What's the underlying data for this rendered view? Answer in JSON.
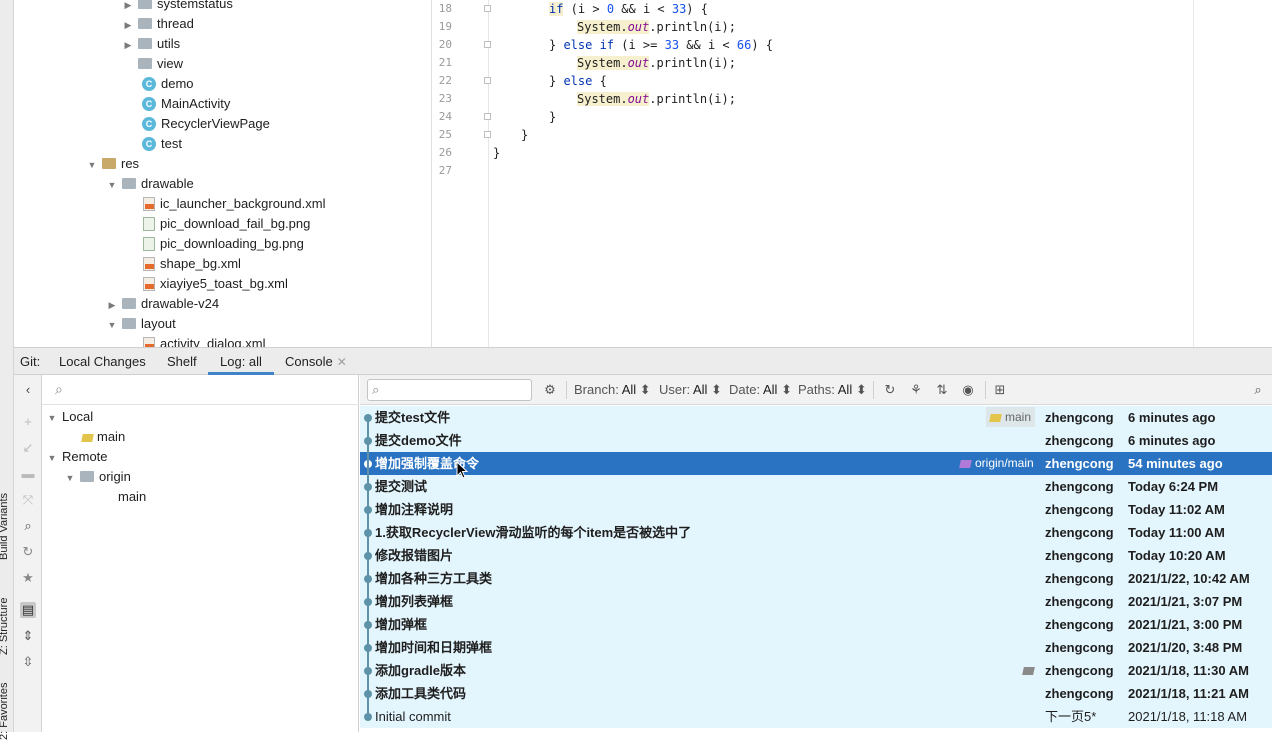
{
  "left_strip": {
    "labels": [
      "Build Variants",
      "Z: Structure",
      "2: Favorites"
    ]
  },
  "project_tree": {
    "rows": [
      {
        "label": "systemstatus",
        "kind": "folder",
        "expanded": false
      },
      {
        "label": "thread",
        "kind": "folder",
        "expanded": false
      },
      {
        "label": "utils",
        "kind": "folder",
        "expanded": false
      },
      {
        "label": "view",
        "kind": "folder",
        "expanded": null
      },
      {
        "label": "demo",
        "kind": "class"
      },
      {
        "label": "MainActivity",
        "kind": "class"
      },
      {
        "label": "RecyclerViewPage",
        "kind": "class"
      },
      {
        "label": "test",
        "kind": "class"
      },
      {
        "label": "res",
        "kind": "res-folder",
        "expanded": true
      },
      {
        "label": "drawable",
        "kind": "folder",
        "expanded": true
      },
      {
        "label": "ic_launcher_background.xml",
        "kind": "xml"
      },
      {
        "label": "pic_download_fail_bg.png",
        "kind": "png"
      },
      {
        "label": "pic_downloading_bg.png",
        "kind": "png"
      },
      {
        "label": "shape_bg.xml",
        "kind": "xml"
      },
      {
        "label": "xiayiye5_toast_bg.xml",
        "kind": "xml"
      },
      {
        "label": "drawable-v24",
        "kind": "folder",
        "expanded": false
      },
      {
        "label": "layout",
        "kind": "folder",
        "expanded": true
      },
      {
        "label": "activity_dialog.xml",
        "kind": "xml"
      }
    ]
  },
  "editor": {
    "line_numbers": [
      "18",
      "19",
      "20",
      "21",
      "22",
      "23",
      "24",
      "25",
      "26",
      "27"
    ],
    "lines": {
      "l18": {
        "kw1": "if",
        "a": " (i > ",
        "n1": "0",
        "b": " && i < ",
        "n2": "33",
        "c": ") {"
      },
      "l19": {
        "sys": "System.",
        "out": "out",
        "rest": ".println(i);"
      },
      "l20": {
        "a": "} ",
        "kw1": "else if",
        "b": " (i >= ",
        "n1": "33",
        "c": " && i < ",
        "n2": "66",
        "d": ") {"
      },
      "l21": {
        "sys": "System.",
        "out": "out",
        "rest": ".println(i);"
      },
      "l22": {
        "a": "} ",
        "kw1": "else",
        "b": " {"
      },
      "l23": {
        "sys": "System.",
        "out": "out",
        "rest": ".println(i);"
      },
      "l24": {
        "text": "}"
      },
      "l25": {
        "text": "}"
      },
      "l26": {
        "text": "}"
      }
    }
  },
  "git": {
    "label": "Git:",
    "tabs": {
      "local_changes": "Local Changes",
      "shelf": "Shelf",
      "log": "Log: all",
      "console": "Console"
    },
    "branches": {
      "local": "Local",
      "local_main": "main",
      "remote": "Remote",
      "origin": "origin",
      "origin_main": "main"
    },
    "filters": {
      "branch": {
        "label": "Branch:",
        "value": "All"
      },
      "user": {
        "label": "User:",
        "value": "All"
      },
      "date": {
        "label": "Date:",
        "value": "All"
      },
      "paths": {
        "label": "Paths:",
        "value": "All"
      }
    },
    "commits": [
      {
        "message": "提交test文件",
        "ref": "main",
        "author": "zhengcong",
        "date": "6 minutes ago"
      },
      {
        "message": "提交demo文件",
        "ref": "",
        "author": "zhengcong",
        "date": "6 minutes ago"
      },
      {
        "message": "增加强制覆盖命令",
        "ref": "origin/main",
        "author": "zhengcong",
        "date": "54 minutes ago",
        "selected": true
      },
      {
        "message": "提交测试",
        "ref": "",
        "author": "zhengcong",
        "date": "Today 6:24 PM"
      },
      {
        "message": "增加注释说明",
        "ref": "",
        "author": "zhengcong",
        "date": "Today 11:02 AM"
      },
      {
        "message": "1.获取RecyclerView滑动监听的每个item是否被选中了",
        "ref": "",
        "author": "zhengcong",
        "date": "Today 11:00 AM"
      },
      {
        "message": "修改报错图片",
        "ref": "",
        "author": "zhengcong",
        "date": "Today 10:20 AM"
      },
      {
        "message": "增加各种三方工具类",
        "ref": "",
        "author": "zhengcong",
        "date": "2021/1/22, 10:42 AM"
      },
      {
        "message": "增加列表弹框",
        "ref": "",
        "author": "zhengcong",
        "date": "2021/1/21, 3:07 PM"
      },
      {
        "message": "增加弹框",
        "ref": "",
        "author": "zhengcong",
        "date": "2021/1/21, 3:00 PM"
      },
      {
        "message": "增加时间和日期弹框",
        "ref": "",
        "author": "zhengcong",
        "date": "2021/1/20, 3:48 PM"
      },
      {
        "message": "添加gradle版本",
        "ref": "",
        "author": "zhengcong",
        "date": "2021/1/18, 11:30 AM",
        "tag": true
      },
      {
        "message": "添加工具类代码",
        "ref": "",
        "author": "zhengcong",
        "date": "2021/1/18, 11:21 AM"
      },
      {
        "message": "Initial commit",
        "ref": "",
        "author": "下一页5*",
        "date": "2021/1/18, 11:18 AM",
        "plain": true
      }
    ]
  },
  "colors": {
    "selection": "#2a73c2",
    "row_bg": "#e3f5fd",
    "graph": "#5e92a8",
    "accent_tab": "#4083c9"
  }
}
